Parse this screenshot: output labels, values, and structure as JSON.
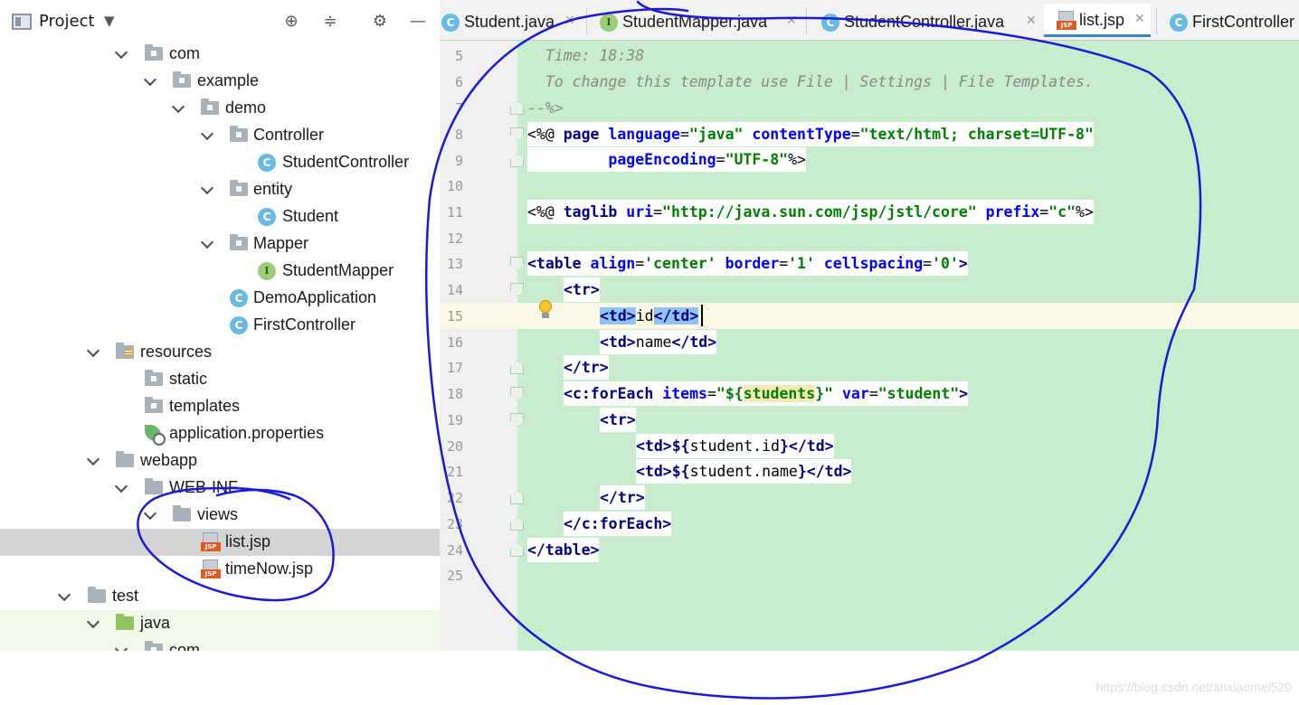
{
  "project_panel": {
    "title": "Project",
    "icons": [
      "locate-icon",
      "collapse-all-icon",
      "gear-icon",
      "minimize-icon"
    ],
    "tree": [
      {
        "label": "com",
        "icon": "folder-icon",
        "expanded": true
      },
      {
        "label": "example",
        "icon": "folder-icon",
        "expanded": true
      },
      {
        "label": "demo",
        "icon": "folder-icon",
        "expanded": true
      },
      {
        "label": "Controller",
        "icon": "folder-icon",
        "expanded": true
      },
      {
        "label": "StudentController",
        "icon": "java-class-icon"
      },
      {
        "label": "entity",
        "icon": "folder-icon",
        "expanded": true
      },
      {
        "label": "Student",
        "icon": "java-class-icon"
      },
      {
        "label": "Mapper",
        "icon": "folder-icon",
        "expanded": true
      },
      {
        "label": "StudentMapper",
        "icon": "java-interface-icon"
      },
      {
        "label": "DemoApplication",
        "icon": "spring-boot-class-icon"
      },
      {
        "label": "FirstController",
        "icon": "java-class-icon"
      },
      {
        "label": "resources",
        "icon": "resources-folder-icon",
        "expanded": true
      },
      {
        "label": "static",
        "icon": "folder-icon"
      },
      {
        "label": "templates",
        "icon": "folder-icon"
      },
      {
        "label": "application.properties",
        "icon": "spring-properties-icon"
      },
      {
        "label": "webapp",
        "icon": "folder-icon",
        "expanded": true
      },
      {
        "label": "WEB-INF",
        "icon": "folder-icon",
        "expanded": true
      },
      {
        "label": "views",
        "icon": "folder-icon",
        "expanded": true
      },
      {
        "label": "list.jsp",
        "icon": "jsp-file-icon",
        "selected": true
      },
      {
        "label": "timeNow.jsp",
        "icon": "jsp-file-icon"
      },
      {
        "label": "test",
        "icon": "folder-icon",
        "expanded": true
      },
      {
        "label": "java",
        "icon": "test-source-folder-icon",
        "expanded": true
      },
      {
        "label": "com",
        "icon": "folder-icon",
        "expanded": true
      }
    ]
  },
  "tabs": [
    {
      "label": "Student.java",
      "icon": "java-class-icon"
    },
    {
      "label": "StudentMapper.java",
      "icon": "java-interface-icon"
    },
    {
      "label": "StudentController.java",
      "icon": "java-class-icon"
    },
    {
      "label": "list.jsp",
      "icon": "jsp-file-icon",
      "active": true
    },
    {
      "label": "FirstController",
      "icon": "java-class-icon"
    }
  ],
  "editor": {
    "line_numbers": [
      "5",
      "6",
      "7",
      "8",
      "9",
      "10",
      "11",
      "12",
      "13",
      "14",
      "15",
      "16",
      "17",
      "18",
      "19",
      "20",
      "21",
      "22",
      "23",
      "24",
      "25"
    ],
    "comment_time": "  Time: 18:38",
    "comment_template": "  To change this template use File | Settings | File Templates.",
    "comment_end": "--%>",
    "current_line": "15",
    "code": {
      "l8": {
        "open": "<%@ ",
        "kw": "page ",
        "a1": "language",
        "s1": "\"java\"",
        "a2": " contentType",
        "s2": "\"text/html; charset=UTF-8\""
      },
      "l9": {
        "a": "pageEncoding",
        "s": "\"UTF-8\"",
        "close": "%>"
      },
      "l11": {
        "open": "<%@ ",
        "kw": "taglib ",
        "a1": "uri",
        "s1": "\"http://java.sun.com/jsp/jstl/core\"",
        "a2": " prefix",
        "s2": "\"c\"",
        "close": "%>"
      },
      "l13": {
        "tag": "<table ",
        "a1": "align",
        "s1": "'center'",
        "a2": " border",
        "s2": "'1'",
        "a3": " cellspacing",
        "s3": "'0'",
        "close": ">"
      },
      "l14": {
        "lt": "<",
        "el": "tr",
        "gt": ">"
      },
      "l15": {
        "open_td": "<td>",
        "text": "id",
        "close_td": "</td>"
      },
      "l16": {
        "open_td": "<td>",
        "text": "name",
        "close_td": "</td>"
      },
      "l17": {
        "lt": "</",
        "el": "tr",
        "gt": ">"
      },
      "l18": {
        "lt": "<",
        "el": "c:forEach ",
        "a": "items",
        "s1": "\"${",
        "var_ref": "students",
        "s2": "}\"",
        "a2": " var",
        "s3": "\"student\"",
        "gt": ">"
      },
      "l19": {
        "lt": "<",
        "el": "tr",
        "gt": ">"
      },
      "l20": {
        "open_td": "<td>",
        "expr": "${",
        "text": "student.id",
        "expr_end": "}",
        "close_td": "</td>"
      },
      "l21": {
        "open_td": "<td>",
        "expr": "${",
        "text": "student.name",
        "expr_end": "}",
        "close_td": "</td>"
      },
      "l22": {
        "lt": "</",
        "el": "tr",
        "gt": ">"
      },
      "l23": {
        "lt": "</",
        "el": "c:forEach",
        "gt": ">"
      },
      "l24": {
        "lt": "</",
        "el": "table",
        "gt": ">"
      }
    }
  },
  "watermark": "https://blog.csdn.net/anxiaomei520",
  "colors": {
    "editor_background": "#c7edcc",
    "gutter_background": "#f0f0f0",
    "selection_row": "#d4d4d4",
    "annotation_ink": "#1a1ad6",
    "active_tab_underline": "#4083c9"
  }
}
